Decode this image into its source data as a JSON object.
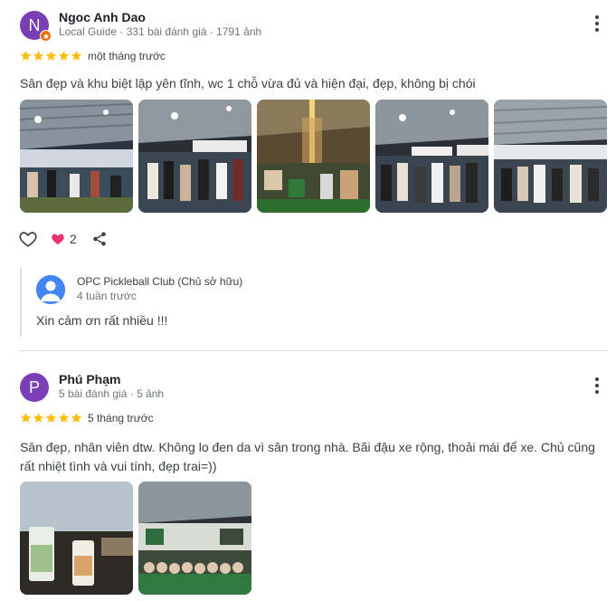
{
  "reviews": [
    {
      "avatar_letter": "N",
      "name": "Ngoc Anh Dao",
      "meta": "Local Guide · 331 bài đánh giá · 1791 ảnh",
      "rating": 5,
      "when": "một tháng trước",
      "text": "Sân đẹp và khu biệt lập yên tĩnh, wc 1 chỗ vừa đủ và hiện đại, đẹp, không bị chói",
      "photo_count": 5,
      "like_count": "2",
      "owner_reply": {
        "name": "OPC Pickleball Club (Chủ sở hữu)",
        "when": "4 tuần trước",
        "text": "Xin cảm ơn rất nhiều !!!"
      }
    },
    {
      "avatar_letter": "P",
      "name": "Phú Phạm",
      "meta": "5 bài đánh giá · 5 ảnh",
      "rating": 5,
      "when": "5 tháng trước",
      "text": "Sân đẹp, nhân viên dtw. Không lo đen da vì sân trong nhà. Bãi đậu xe rộng, thoải mái để xe. Chủ cũng rất nhiệt tình và vui tính, đẹp trai=))",
      "photo_count": 2
    }
  ],
  "colors": {
    "star": "#fbbc04",
    "avatar": "#7b3fb5",
    "local_guide_badge": "#e8710a",
    "heart": "#e8336f"
  }
}
